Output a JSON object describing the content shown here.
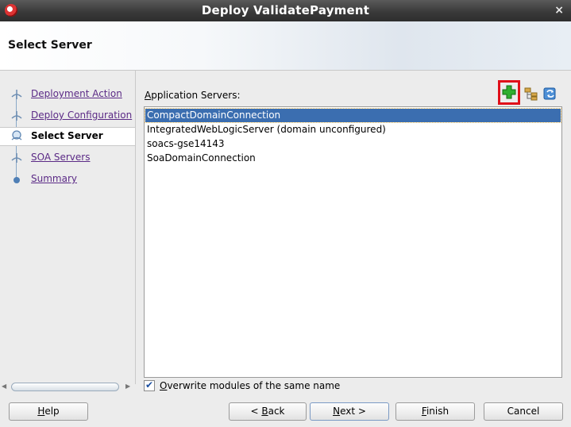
{
  "window": {
    "title": "Deploy ValidatePayment",
    "close_glyph": "×"
  },
  "header": {
    "title": "Select Server"
  },
  "nav": {
    "items": [
      {
        "label": "Deployment Action",
        "state": "done"
      },
      {
        "label": "Deploy Configuration",
        "state": "done"
      },
      {
        "label": "Select Server",
        "state": "active"
      },
      {
        "label": "SOA Servers",
        "state": "todo"
      },
      {
        "label": "Summary",
        "state": "todo"
      }
    ]
  },
  "main": {
    "servers_label_mnemonic": "A",
    "servers_label_rest": "pplication Servers:",
    "toolbar": {
      "add_icon": "add-plus-icon",
      "browse_icon": "server-tree-icon",
      "refresh_icon": "refresh-icon"
    },
    "servers": [
      "CompactDomainConnection",
      "IntegratedWebLogicServer (domain unconfigured)",
      "soacs-gse14143",
      "SoaDomainConnection"
    ],
    "selected_index": 0,
    "overwrite": {
      "checked": true,
      "mnemonic": "O",
      "rest": "verwrite modules of the same name"
    }
  },
  "buttons": {
    "help": {
      "mnemonic": "H",
      "rest": "elp"
    },
    "back": {
      "prefix": "< ",
      "mnemonic": "B",
      "rest": "ack"
    },
    "next": {
      "mnemonic": "N",
      "rest": "ext >"
    },
    "finish": {
      "mnemonic": "F",
      "rest": "inish"
    },
    "cancel": {
      "label": "Cancel"
    }
  },
  "colors": {
    "selection": "#3b6eb0",
    "link": "#5b2a86",
    "highlight_box": "#e0101a"
  }
}
